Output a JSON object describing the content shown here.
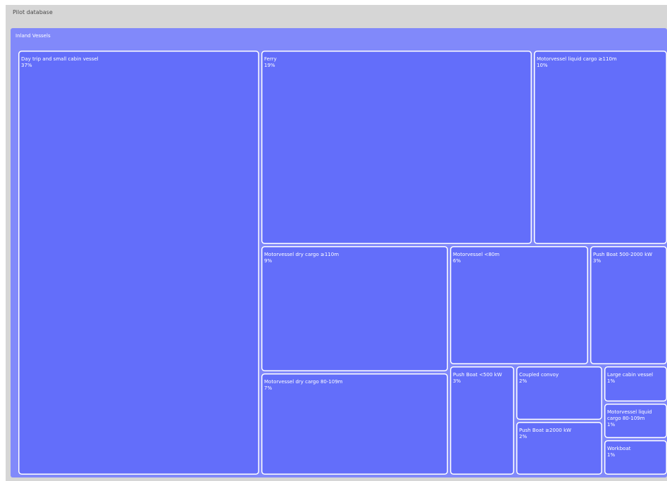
{
  "chart_data": {
    "type": "treemap",
    "title": "Pilot database",
    "group": "Inland Vessels",
    "colors": {
      "frame": "#d6d6d6",
      "group_fill": "#8189fa",
      "cell_fill": "#636efa",
      "cell_stroke": "#ffffff"
    },
    "items": [
      {
        "label": "Day trip and small cabin vessel",
        "pct_label": "37%",
        "value": 37
      },
      {
        "label": "Ferry",
        "pct_label": "19%",
        "value": 19
      },
      {
        "label": "Motorvessel liquid cargo ≥110m",
        "pct_label": "10%",
        "value": 10
      },
      {
        "label": "Motorvessel dry cargo ≥110m",
        "pct_label": "9%",
        "value": 9
      },
      {
        "label": "Motorvessel dry cargo 80-109m",
        "pct_label": "7%",
        "value": 7
      },
      {
        "label": "Motorvessel <80m",
        "pct_label": "6%",
        "value": 6
      },
      {
        "label": "Push Boat <500 kW",
        "pct_label": "3%",
        "value": 3
      },
      {
        "label": "Push Boat 500-2000 kW",
        "pct_label": "3%",
        "value": 3
      },
      {
        "label": "Coupled convoy",
        "pct_label": "2%",
        "value": 2
      },
      {
        "label": "Push Boat ≥2000 kW",
        "pct_label": "2%",
        "value": 2
      },
      {
        "label": "Large cabin vessel",
        "pct_label": "1%",
        "value": 1
      },
      {
        "label": "Motorvessel liquid cargo 80-109m",
        "pct_label": "1%",
        "value": 1
      },
      {
        "label": "Workboat",
        "pct_label": "1%",
        "value": 1
      }
    ]
  }
}
